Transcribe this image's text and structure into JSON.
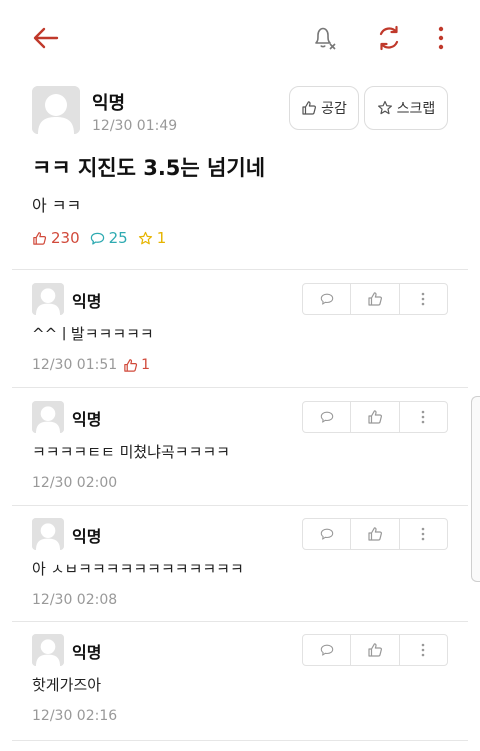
{
  "topbar": {
    "icons": [
      "back-arrow-icon",
      "notification-off-icon",
      "refresh-icon",
      "more-vertical-icon"
    ],
    "accent": "#c0392b"
  },
  "post": {
    "author": "익명",
    "time": "12/30 01:49",
    "like_button": "공감",
    "scrap_button": "스크랩",
    "title": "ㅋㅋ 지진도 3.5는 넘기네",
    "body": "아 ㅋㅋ",
    "stats": {
      "likes": "230",
      "comments": "25",
      "scraps": "1"
    }
  },
  "comments": [
    {
      "author": "익명",
      "text": "^^ㅣ발ㅋㅋㅋㅋㅋ",
      "time": "12/30 01:51",
      "likes": "1"
    },
    {
      "author": "익명",
      "text": "ㅋㅋㅋㅋㅌㅌ 미쳤냐곡ㅋㅋㅋㅋ",
      "time": "12/30 02:00"
    },
    {
      "author": "익명",
      "text": "아 ㅅㅂㅋㅋㅋㅋㅋㅋㅋㅋㅋㅋㅋㅋ",
      "time": "12/30 02:08"
    },
    {
      "author": "익명",
      "text": "핫게가즈아",
      "time": "12/30 02:16"
    }
  ],
  "colors": {
    "like": "#d14a3b",
    "comment": "#2eaab1",
    "scrap": "#e6b400",
    "muted": "#999999"
  }
}
